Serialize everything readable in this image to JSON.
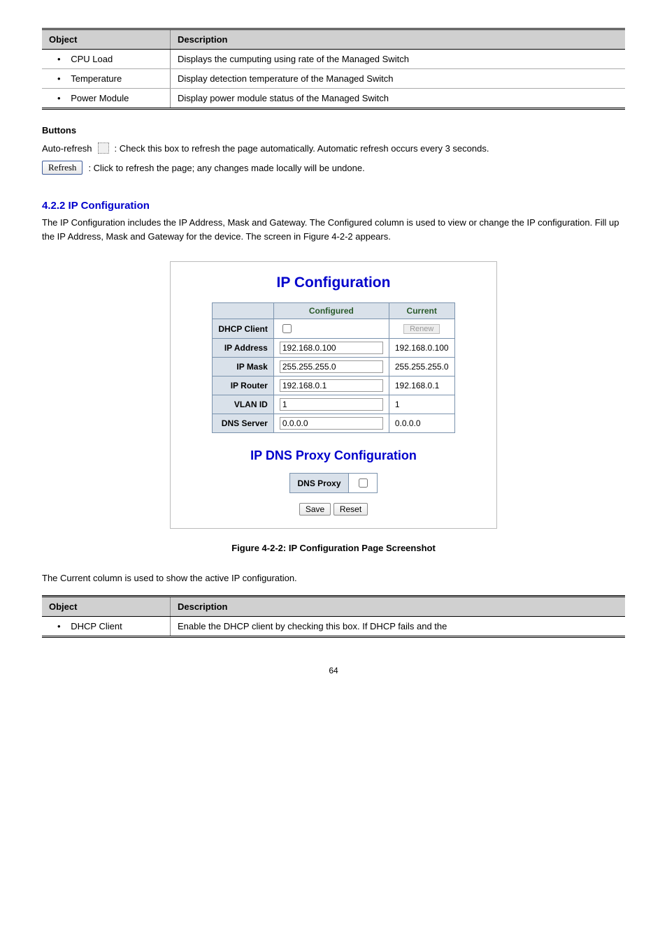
{
  "top_table": {
    "headers": [
      "Object",
      "Description"
    ],
    "rows": [
      {
        "object": "CPU Load",
        "desc": "Displays the cumputing using rate of the Managed Switch"
      },
      {
        "object": "Temperature",
        "desc": "Display detection temperature of the Managed Switch"
      },
      {
        "object": "Power Module",
        "desc": "Display power module status of the Managed Switch"
      }
    ]
  },
  "buttons_header": "Buttons",
  "auto_refresh": {
    "prefix": "Auto-refresh",
    "suffix": ": Check this box to refresh the page automatically. Automatic refresh occurs every 3 seconds."
  },
  "refresh_row": {
    "btn": "Refresh",
    "suffix": ": Click to refresh the page; any changes made locally will be undone."
  },
  "section_title": "4.2.2 IP Configuration",
  "section_para": "The IP Configuration includes the IP Address, Mask and Gateway. The Configured column is used to view or change the IP configuration. Fill up the IP Address, Mask and Gateway for the device. The screen in Figure 4-2-2 appears.",
  "figure": {
    "title": "IP Configuration",
    "head": [
      "",
      "Configured",
      "Current"
    ],
    "rows": [
      {
        "label": "DHCP Client",
        "configured_type": "checkbox",
        "current_btn": "Renew"
      },
      {
        "label": "IP Address",
        "configured": "192.168.0.100",
        "current": "192.168.0.100"
      },
      {
        "label": "IP Mask",
        "configured": "255.255.255.0",
        "current": "255.255.255.0"
      },
      {
        "label": "IP Router",
        "configured": "192.168.0.1",
        "current": "192.168.0.1"
      },
      {
        "label": "VLAN ID",
        "configured": "1",
        "current": "1"
      },
      {
        "label": "DNS Server",
        "configured": "0.0.0.0",
        "current": "0.0.0.0"
      }
    ],
    "title2": "IP DNS Proxy Configuration",
    "dns_proxy_label": "DNS Proxy",
    "save": "Save",
    "reset": "Reset"
  },
  "fig_caption": "Figure 4-2-2: IP Configuration Page Screenshot",
  "current_col_para": "The Current column is used to show the active IP configuration.",
  "bottom_table": {
    "headers": [
      "Object",
      "Description"
    ],
    "rows": [
      {
        "object": "DHCP Client",
        "desc": "Enable the DHCP client by checking this box. If DHCP fails and the"
      }
    ]
  },
  "page_num": "64"
}
